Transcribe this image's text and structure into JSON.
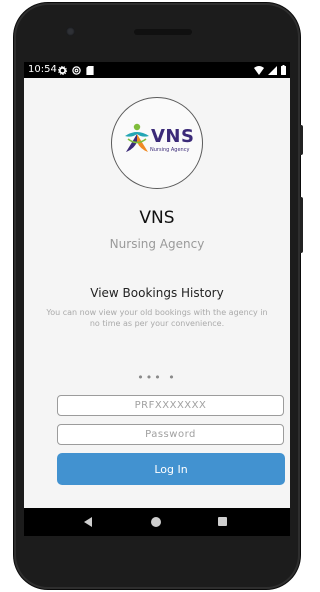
{
  "status_bar": {
    "time": "10:54",
    "left_icons": [
      "gear-icon",
      "at-sign-icon",
      "sd-card-icon"
    ],
    "right_icons": [
      "wifi-icon",
      "signal-icon",
      "battery-icon"
    ]
  },
  "logo": {
    "brand": "VNS",
    "tagline": "Nursing Agency",
    "colors": {
      "purple": "#3b2a78",
      "teal": "#23a6b5",
      "green": "#7fbd3b",
      "orange": "#f08a24"
    }
  },
  "app": {
    "title": "VNS",
    "subtitle": "Nursing Agency"
  },
  "feature": {
    "title": "View Bookings History",
    "description": "You can now view your old bookings with the agency in no time as per your convenience."
  },
  "carousel": {
    "indicator": "•••  •"
  },
  "login_form": {
    "username_placeholder": "PRFXXXXXXX",
    "password_placeholder": "Password",
    "login_label": "Log In"
  },
  "colors": {
    "accent": "#4292d0",
    "background": "#f5f5f5"
  }
}
